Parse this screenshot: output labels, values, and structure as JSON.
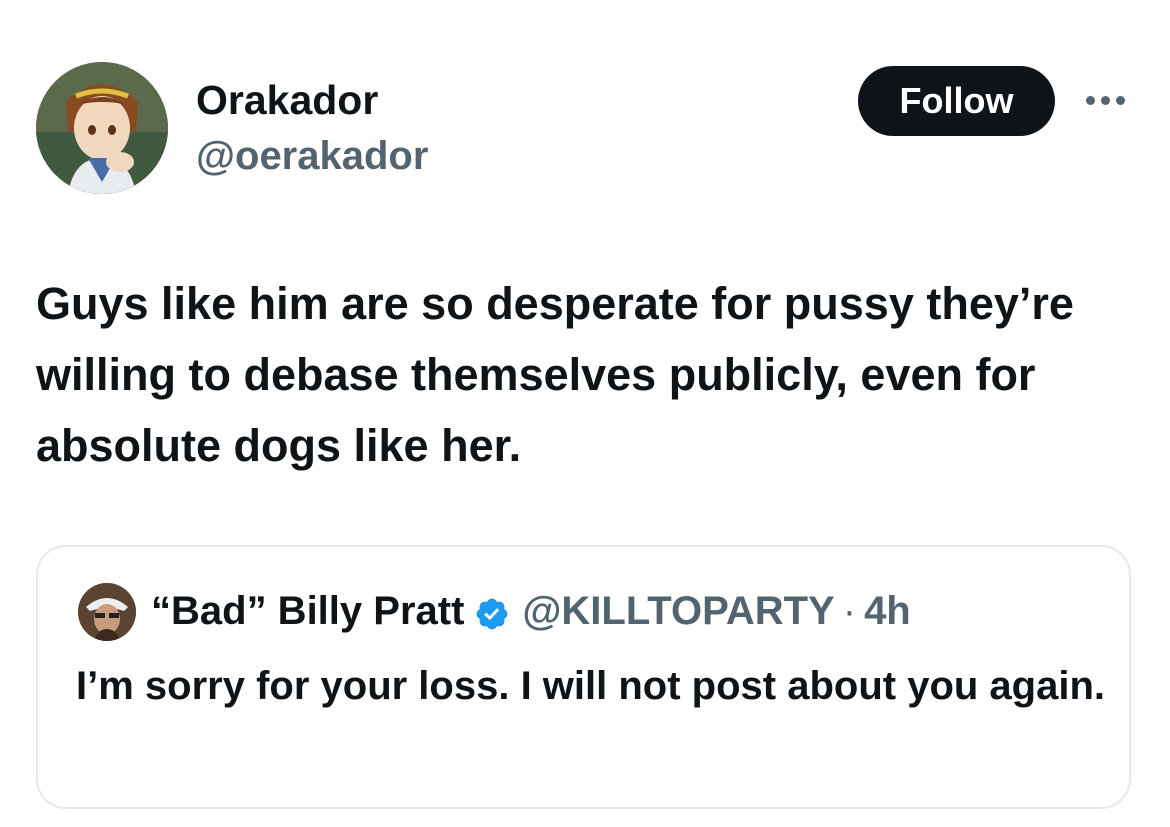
{
  "author": {
    "display_name": "Orakador",
    "handle": "@oerakador",
    "avatar_icon": "anime-character-avatar"
  },
  "actions": {
    "follow_label": "Follow",
    "more_icon": "more-dots-icon"
  },
  "tweet": {
    "text": "Guys like him are so desperate for pussy they’re willing to debase themselves publicly, even for absolute dogs like her."
  },
  "quoted_tweet": {
    "display_name": "“Bad” Billy Pratt",
    "verified": true,
    "handle": "@KILLTOPARTY",
    "separator": "·",
    "time": "4h",
    "text": "I’m sorry for your loss. I will not post about you again."
  },
  "colors": {
    "text_primary": "#0f1419",
    "text_secondary": "#536471",
    "follow_bg": "#0f1419",
    "verified_blue": "#1d9bf0",
    "card_border": "#e6e9ec"
  }
}
